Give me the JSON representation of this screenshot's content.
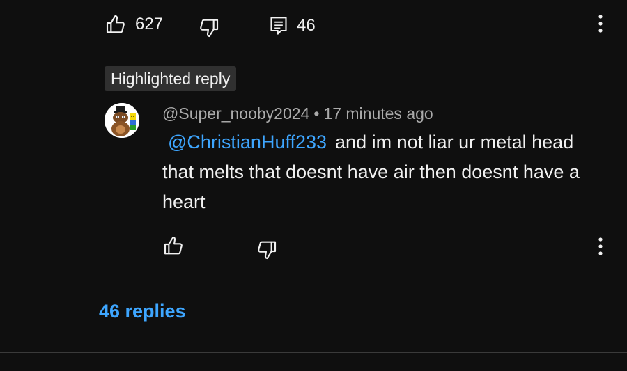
{
  "parent_comment": {
    "like_count": "627",
    "reply_count": "46"
  },
  "highlighted_reply": {
    "chip_label": "Highlighted reply",
    "author": "@Super_nooby2024",
    "separator": "•",
    "timestamp": "17 minutes ago",
    "mention": "@ChristianHuff233",
    "text": "and im not liar ur metal head that melts that doesnt have air then doesnt have a heart"
  },
  "replies_link": "46 replies",
  "colors": {
    "background": "#0f0f0f",
    "link_blue": "#3ea6ff",
    "meta_gray": "#aaaaaa",
    "chip_bg": "#303030"
  },
  "icons": {
    "like": "thumbs-up-icon",
    "dislike": "thumbs-down-icon",
    "reply": "comment-icon",
    "more": "more-vertical-icon"
  }
}
